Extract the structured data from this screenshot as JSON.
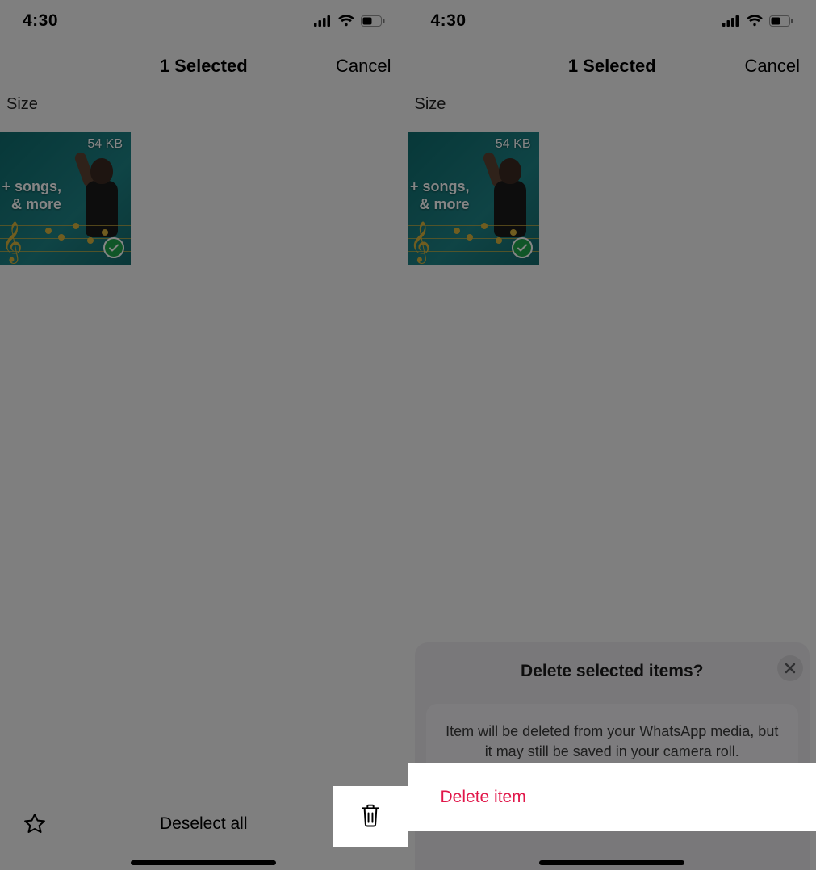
{
  "status": {
    "time": "4:30"
  },
  "nav": {
    "title": "1 Selected",
    "cancel": "Cancel"
  },
  "section": {
    "label": "Size"
  },
  "thumb": {
    "size": "54 KB",
    "line1": "+ songs,",
    "line2": "& more"
  },
  "toolbar": {
    "deselect": "Deselect all"
  },
  "sheet": {
    "title": "Delete selected items?",
    "message": "Item will be deleted from your WhatsApp media, but it may still be saved in your camera roll.",
    "delete": "Delete item"
  }
}
